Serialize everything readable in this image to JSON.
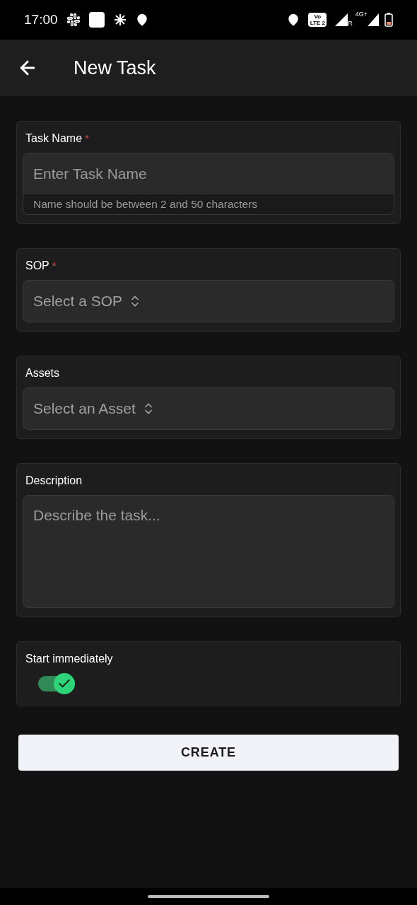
{
  "status_bar": {
    "time": "17:00",
    "volte": "Vo LTE 2",
    "roaming": "R",
    "network": "4G+"
  },
  "header": {
    "title": "New Task"
  },
  "fields": [
    {
      "kind": "text",
      "label": "Task Name",
      "required_mark": "*",
      "placeholder": "Enter Task Name",
      "helper": "Name should be between 2 and 50 characters"
    },
    {
      "kind": "select",
      "label": "SOP",
      "required_mark": "*",
      "placeholder": "Select a SOP"
    },
    {
      "kind": "select",
      "label": "Assets",
      "placeholder": "Select an Asset"
    },
    {
      "kind": "textarea",
      "label": "Description",
      "placeholder": "Describe the task..."
    },
    {
      "kind": "switch",
      "label": "Start immediately",
      "on": true
    }
  ],
  "submit": {
    "label": "CREATE"
  }
}
